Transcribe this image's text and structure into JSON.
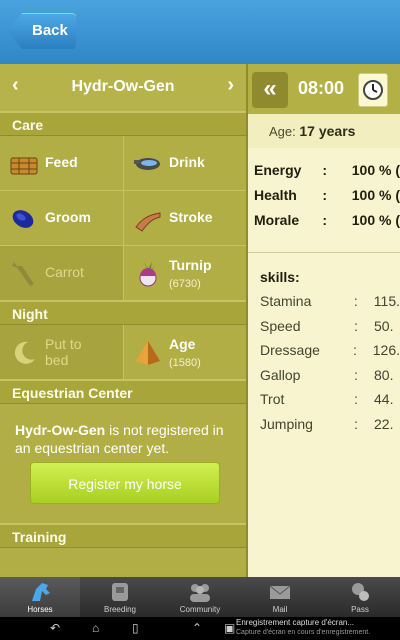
{
  "header": {
    "back_label": "Back"
  },
  "horse": {
    "name": "Hydr-Ow-Gen",
    "prev_icon": "chevron-left-icon",
    "next_icon": "chevron-right-icon"
  },
  "sections": {
    "care": "Care",
    "night": "Night",
    "equestrian": "Equestrian Center",
    "training": "Training"
  },
  "care_actions": [
    {
      "label": "Feed",
      "icon": "hay-bale-icon"
    },
    {
      "label": "Drink",
      "icon": "water-bowl-icon"
    },
    {
      "label": "Groom",
      "icon": "brush-icon"
    },
    {
      "label": "Stroke",
      "icon": "hand-icon"
    },
    {
      "label": "Carrot",
      "icon": "carrot-icon",
      "disabled": true
    },
    {
      "label": "Turnip",
      "sub": "(6730)",
      "icon": "turnip-icon"
    }
  ],
  "night_actions": [
    {
      "label": "Put to bed",
      "icon": "moon-icon",
      "disabled": true
    },
    {
      "label": "Age",
      "sub": "(1580)",
      "icon": "pyramid-icon"
    }
  ],
  "equestrian": {
    "message_name": "Hydr-Ow-Gen",
    "message_rest": " is not registered in an equestrian center yet.",
    "register_label": "Register my horse"
  },
  "status": {
    "collapse_icon": "double-chevron-left-icon",
    "time": "08:00",
    "clock_icon": "clock-icon",
    "age_label": "Age:",
    "age_value": "17 years"
  },
  "stats": [
    {
      "name": "Energy",
      "value": "100 % ("
    },
    {
      "name": "Health",
      "value": "100 % ("
    },
    {
      "name": "Morale",
      "value": "100 % ("
    }
  ],
  "skills": {
    "title": "skills:",
    "items": [
      {
        "name": "Stamina",
        "value": "115."
      },
      {
        "name": "Speed",
        "value": "50."
      },
      {
        "name": "Dressage",
        "value": "126."
      },
      {
        "name": "Gallop",
        "value": "80."
      },
      {
        "name": "Trot",
        "value": "44."
      },
      {
        "name": "Jumping",
        "value": "22."
      }
    ]
  },
  "tabs": [
    {
      "label": "Horses",
      "icon": "horse-icon",
      "active": true
    },
    {
      "label": "Breeding",
      "icon": "breeding-icon"
    },
    {
      "label": "Community",
      "icon": "community-icon"
    },
    {
      "label": "Mail",
      "icon": "mail-icon"
    },
    {
      "label": "Pass",
      "icon": "pass-icon"
    }
  ],
  "system": {
    "notice_title": "Enregistrement capture d'écran...",
    "notice_sub": "Capture d'écran en cours d'enregistrement."
  }
}
